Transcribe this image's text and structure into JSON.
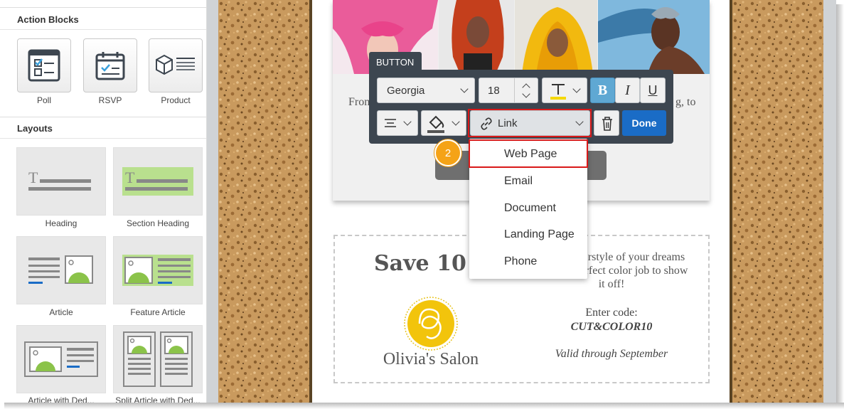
{
  "sidebar": {
    "action_blocks_title": "Action Blocks",
    "action_blocks": [
      {
        "label": "Poll",
        "icon": "poll-icon"
      },
      {
        "label": "RSVP",
        "icon": "rsvp-calendar-icon"
      },
      {
        "label": "Product",
        "icon": "product-box-icon"
      }
    ],
    "layouts_title": "Layouts",
    "layouts": [
      {
        "label": "Heading"
      },
      {
        "label": "Section Heading"
      },
      {
        "label": "Article"
      },
      {
        "label": "Feature Article"
      },
      {
        "label": "Article with Ded..."
      },
      {
        "label": "Split Article with Ded..."
      }
    ]
  },
  "email": {
    "card_text_left": "Fron",
    "card_text_right": "g, to",
    "coupon": {
      "save": "Save 10",
      "promo_line1": "rstyle of your dreams",
      "promo_line2": "rfect color job to show",
      "promo_line3": "it off!",
      "enter_label": "Enter code:",
      "code": "CUT&COLOR10",
      "valid": "Valid through September",
      "salon_name": "Olivia's Salon"
    }
  },
  "toolbar": {
    "tab_label": "BUTTON",
    "font_family": "Georgia",
    "font_size": "18",
    "bold": "B",
    "italic": "I",
    "underline": "U",
    "link_label": "Link",
    "done_label": "Done",
    "text_color_swatch": "#f5d800",
    "fill_color_swatch": "#555555"
  },
  "link_menu": {
    "items": [
      "Web Page",
      "Email",
      "Document",
      "Landing Page",
      "Phone"
    ]
  },
  "step_badge": "2",
  "colors": {
    "highlight": "#d91919",
    "done_button": "#1a6cc6",
    "step_badge": "#f5a317",
    "bold_active": "#5fa8d3"
  }
}
